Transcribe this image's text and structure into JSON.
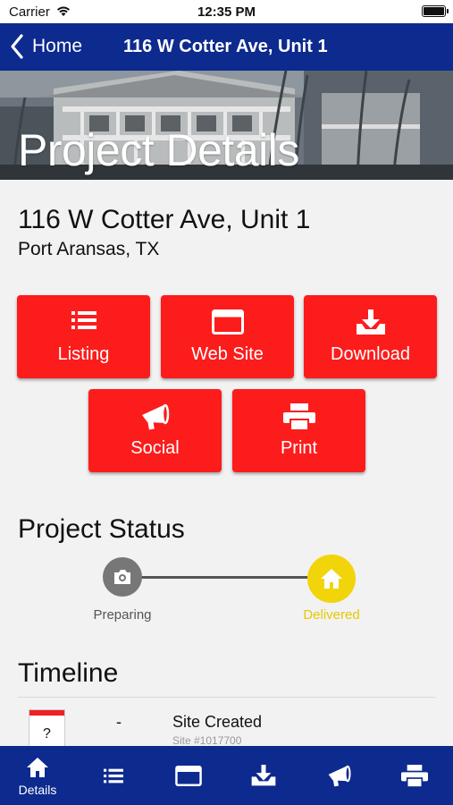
{
  "status_bar": {
    "carrier": "Carrier",
    "time": "12:35 PM"
  },
  "nav": {
    "back_label": "Home",
    "title": "116 W Cotter Ave, Unit 1"
  },
  "hero": {
    "title": "Project Details"
  },
  "address": {
    "line1": "116 W Cotter Ave, Unit 1",
    "line2": "Port Aransas, TX"
  },
  "actions": [
    {
      "label": "Listing",
      "icon": "list-icon"
    },
    {
      "label": "Web Site",
      "icon": "browser-window-icon"
    },
    {
      "label": "Download",
      "icon": "download-icon"
    },
    {
      "label": "Social",
      "icon": "megaphone-icon"
    },
    {
      "label": "Print",
      "icon": "printer-icon"
    }
  ],
  "project_status": {
    "title": "Project Status",
    "steps": [
      {
        "label": "Preparing",
        "icon": "camera-icon",
        "color": "#777777"
      },
      {
        "label": "Delivered",
        "icon": "home-icon",
        "color": "#f2d40a"
      }
    ]
  },
  "timeline": {
    "title": "Timeline",
    "entries": [
      {
        "date_placeholder": "?",
        "dash": "-",
        "event": "Site Created",
        "detail": "Site #1017700"
      }
    ]
  },
  "tab_bar": {
    "tabs": [
      {
        "label": "Details",
        "icon": "home-icon",
        "active": true
      },
      {
        "label": "",
        "icon": "list-icon"
      },
      {
        "label": "",
        "icon": "browser-window-icon"
      },
      {
        "label": "",
        "icon": "download-icon"
      },
      {
        "label": "",
        "icon": "megaphone-icon"
      },
      {
        "label": "",
        "icon": "printer-icon"
      }
    ]
  },
  "colors": {
    "nav_blue": "#0d2a8e",
    "action_red": "#fc1c1c",
    "delivered_yellow": "#f2d40a"
  }
}
